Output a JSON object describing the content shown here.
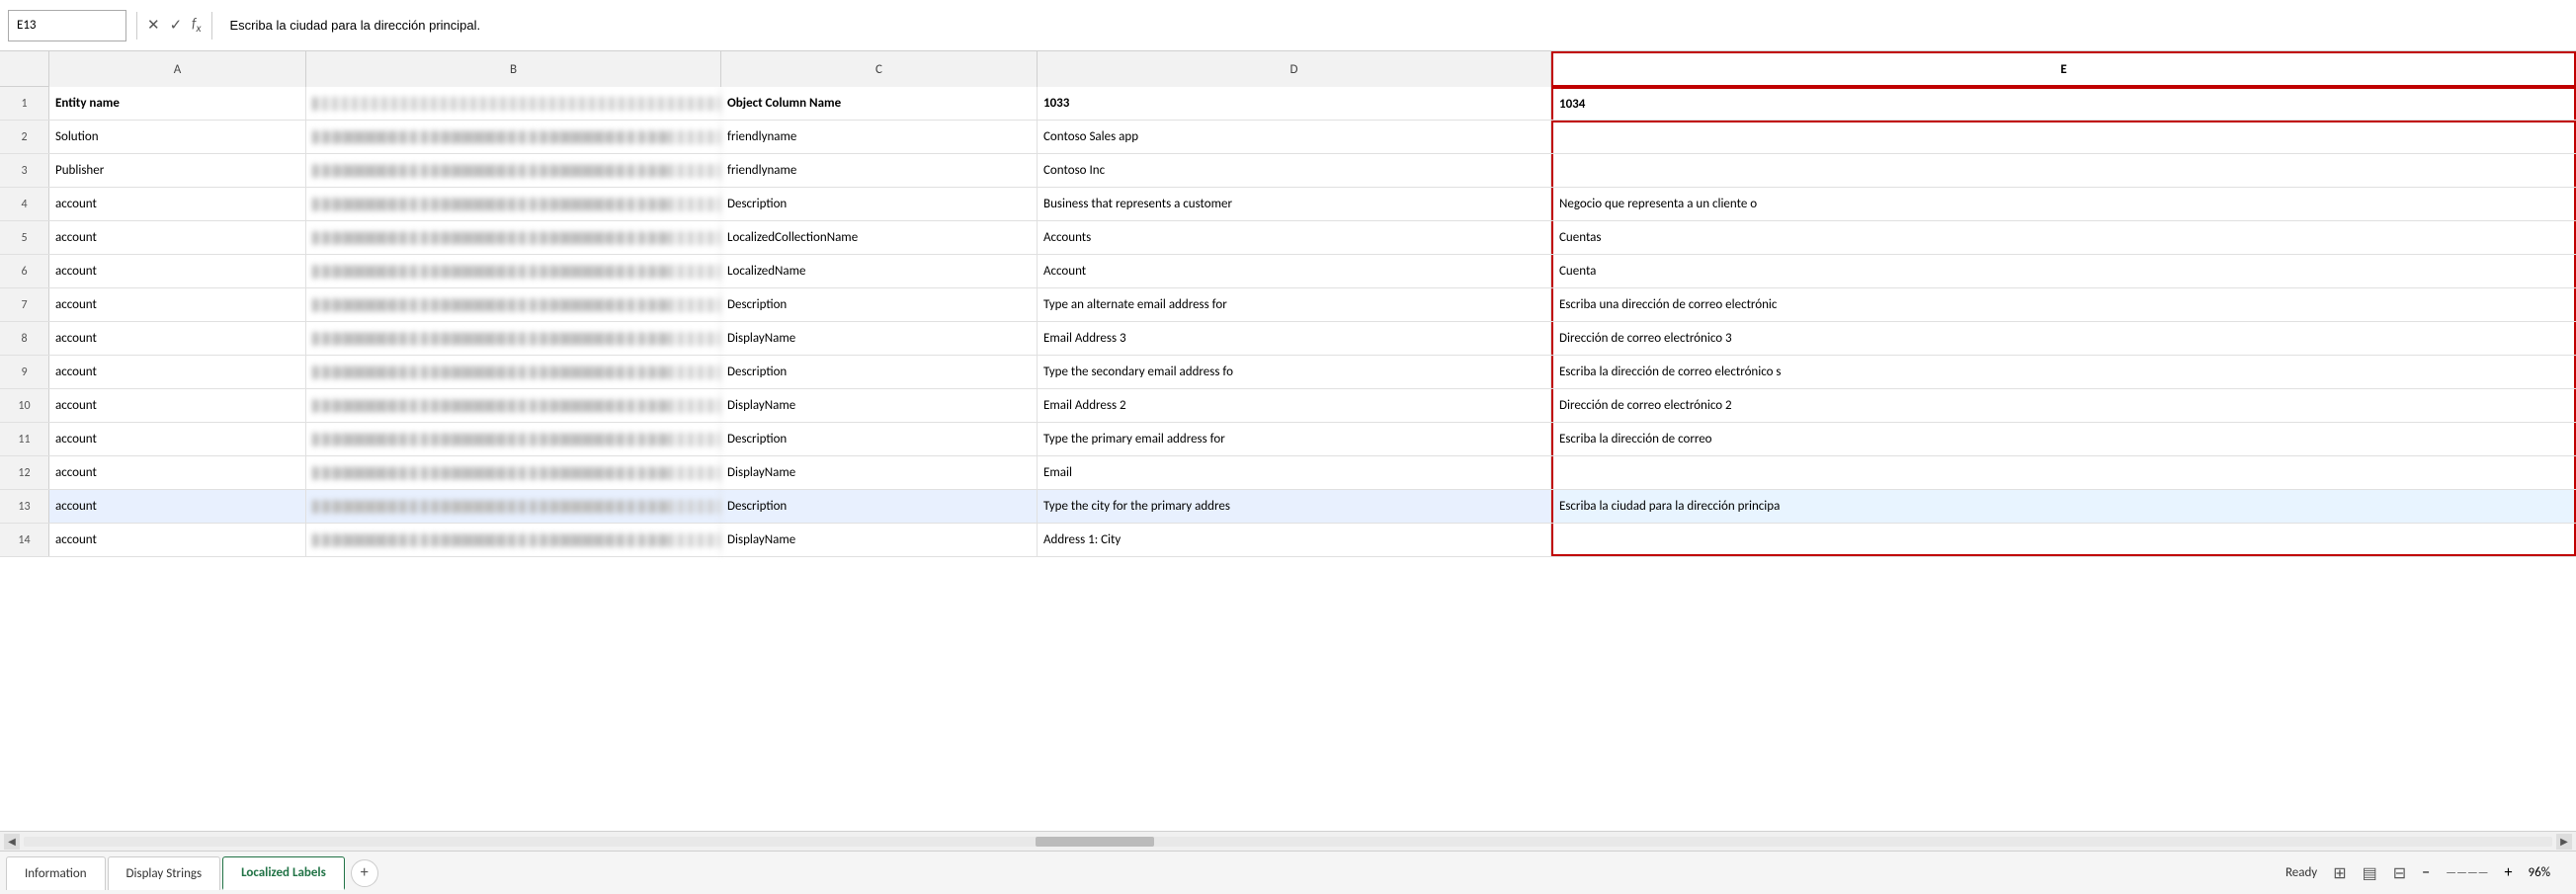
{
  "formulaBar": {
    "cellRef": "E13",
    "formula": "Escriba la ciudad para la dirección principal."
  },
  "columns": {
    "a": "A",
    "b": "B",
    "c": "C",
    "d": "D",
    "e": "E"
  },
  "headers": {
    "row1": {
      "a": "Entity name",
      "b": "",
      "c": "Object Column Name",
      "d": "1033",
      "e": "1034"
    }
  },
  "rows": [
    {
      "num": 2,
      "a": "Solution",
      "c": "friendlyname",
      "d": "Contoso Sales app",
      "e": ""
    },
    {
      "num": 3,
      "a": "Publisher",
      "c": "friendlyname",
      "d": "Contoso Inc",
      "e": ""
    },
    {
      "num": 4,
      "a": "account",
      "c": "Description",
      "d": "Business that represents a customer",
      "e": "Negocio que representa a un cliente o"
    },
    {
      "num": 5,
      "a": "account",
      "c": "LocalizedCollectionName",
      "d": "Accounts",
      "e": "Cuentas"
    },
    {
      "num": 6,
      "a": "account",
      "c": "LocalizedName",
      "d": "Account",
      "e": "Cuenta"
    },
    {
      "num": 7,
      "a": "account",
      "c": "Description",
      "d": "Type an alternate email address for",
      "e": "Escriba una dirección de correo electrónic"
    },
    {
      "num": 8,
      "a": "account",
      "c": "DisplayName",
      "d": "Email Address 3",
      "e": "Dirección de correo electrónico 3"
    },
    {
      "num": 9,
      "a": "account",
      "c": "Description",
      "d": "Type the secondary email address fo",
      "e": "Escriba la dirección de correo electrónico s"
    },
    {
      "num": 10,
      "a": "account",
      "c": "DisplayName",
      "d": "Email Address 2",
      "e": "Dirección de correo electrónico 2"
    },
    {
      "num": 11,
      "a": "account",
      "c": "Description",
      "d": "Type the primary email address for",
      "e": "Escriba la dirección de correo"
    },
    {
      "num": 12,
      "a": "account",
      "c": "DisplayName",
      "d": "Email",
      "e": ""
    },
    {
      "num": 13,
      "a": "account",
      "c": "Description",
      "d": "Type the city for the primary addres",
      "e": "Escriba la ciudad para la dirección principa"
    },
    {
      "num": 14,
      "a": "account",
      "c": "DisplayName",
      "d": "Address 1: City",
      "e": ""
    }
  ],
  "tabs": [
    {
      "id": "information",
      "label": "Information",
      "active": false
    },
    {
      "id": "display-strings",
      "label": "Display Strings",
      "active": false
    },
    {
      "id": "localized-labels",
      "label": "Localized Labels",
      "active": true
    }
  ],
  "addSheetLabel": "+",
  "statusBar": {
    "ready": "Ready",
    "zoom": "96%"
  }
}
